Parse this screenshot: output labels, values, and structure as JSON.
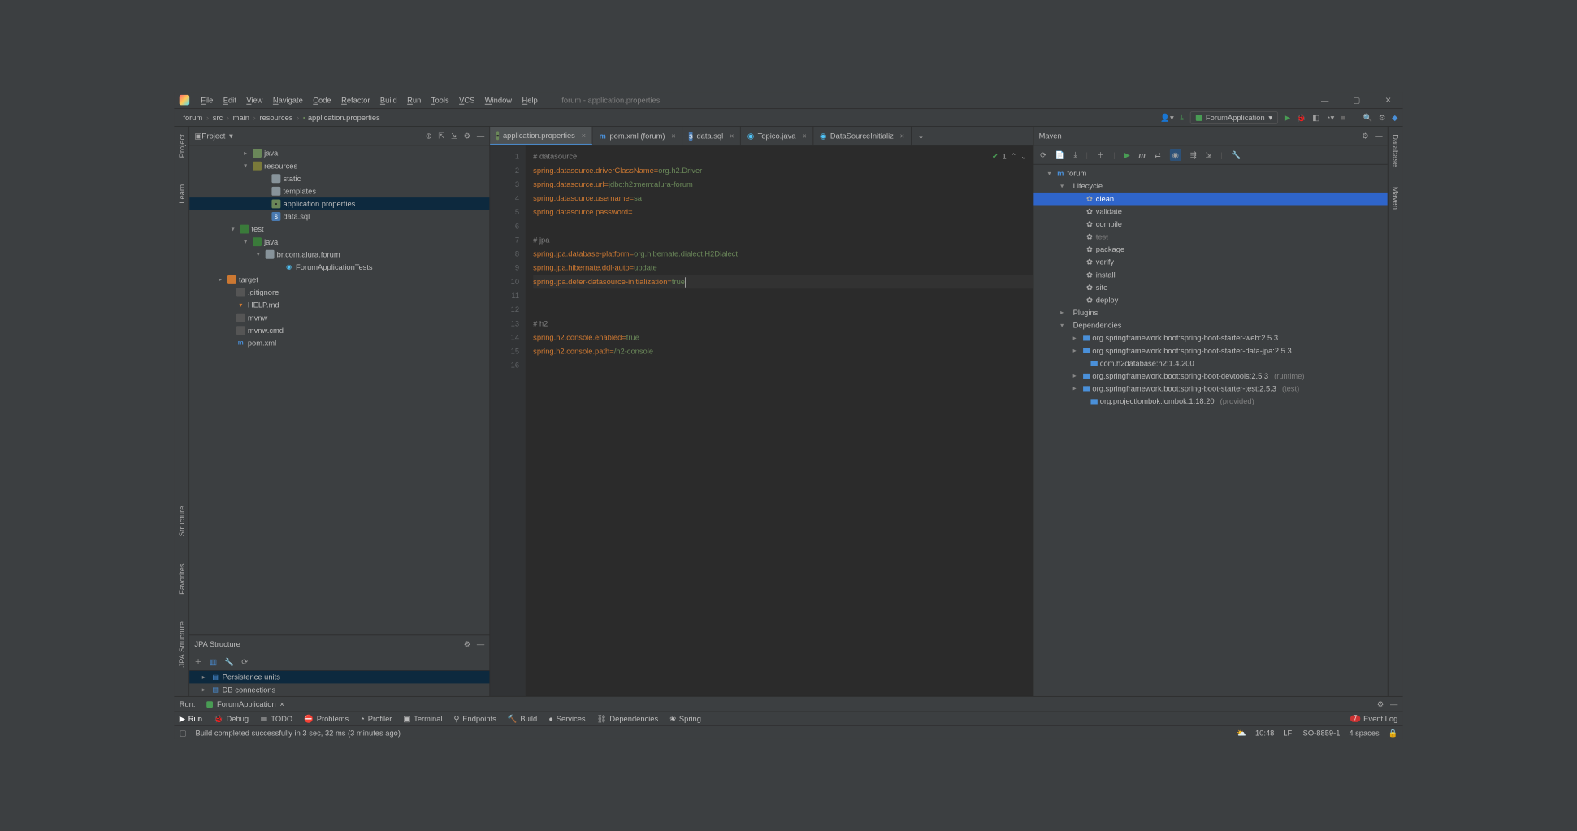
{
  "window": {
    "title": "forum - application.properties"
  },
  "menu": [
    "File",
    "Edit",
    "View",
    "Navigate",
    "Code",
    "Refactor",
    "Build",
    "Run",
    "Tools",
    "VCS",
    "Window",
    "Help"
  ],
  "breadcrumb": [
    "forum",
    "src",
    "main",
    "resources",
    "application.properties"
  ],
  "runConfig": "ForumApplication",
  "leftTabs": [
    "Project",
    "Learn",
    "Structure",
    "Favorites",
    "JPA Structure"
  ],
  "rightTabs": [
    "Database",
    "Maven"
  ],
  "projectHeader": "Project",
  "tree": [
    {
      "ind": 86,
      "exp": "▸",
      "icon": "folder",
      "label": "java"
    },
    {
      "ind": 86,
      "exp": "▾",
      "icon": "folder-res",
      "label": "resources"
    },
    {
      "ind": 116,
      "exp": "",
      "icon": "folder-plain",
      "label": "static"
    },
    {
      "ind": 116,
      "exp": "",
      "icon": "folder-plain",
      "label": "templates"
    },
    {
      "ind": 116,
      "exp": "",
      "icon": "prop",
      "label": "application.properties",
      "sel": true
    },
    {
      "ind": 116,
      "exp": "",
      "icon": "sql",
      "label": "data.sql"
    },
    {
      "ind": 66,
      "exp": "▾",
      "icon": "folder-test",
      "label": "test"
    },
    {
      "ind": 86,
      "exp": "▾",
      "icon": "folder-test",
      "label": "java"
    },
    {
      "ind": 106,
      "exp": "▾",
      "icon": "folder-plain",
      "label": "br.com.alura.forum"
    },
    {
      "ind": 136,
      "exp": "",
      "icon": "class",
      "label": "ForumApplicationTests"
    },
    {
      "ind": 46,
      "exp": "▸",
      "icon": "folder-target",
      "label": "target"
    },
    {
      "ind": 60,
      "exp": "",
      "icon": "file",
      "label": ".gitignore"
    },
    {
      "ind": 60,
      "exp": "",
      "icon": "md",
      "label": "HELP.md"
    },
    {
      "ind": 60,
      "exp": "",
      "icon": "file",
      "label": "mvnw"
    },
    {
      "ind": 60,
      "exp": "",
      "icon": "file",
      "label": "mvnw.cmd"
    },
    {
      "ind": 60,
      "exp": "",
      "icon": "m",
      "label": "pom.xml"
    }
  ],
  "jpa": {
    "header": "JPA Structure",
    "rows": [
      "Persistence units",
      "DB connections"
    ]
  },
  "tabs": [
    {
      "icon": "prop",
      "label": "application.properties",
      "active": true
    },
    {
      "icon": "m",
      "label": "pom.xml (forum)"
    },
    {
      "icon": "sql",
      "label": "data.sql"
    },
    {
      "icon": "kt",
      "label": "Topico.java"
    },
    {
      "icon": "kt",
      "label": "DataSourceInitializ"
    }
  ],
  "code": [
    {
      "t": "comment",
      "v": "# datasource"
    },
    {
      "t": "kv",
      "k": "spring.datasource.driverClassName",
      "v": "org.h2.Driver"
    },
    {
      "t": "kv",
      "k": "spring.datasource.url",
      "v": "jdbc:h2:mem:alura-forum"
    },
    {
      "t": "kv",
      "k": "spring.datasource.username",
      "v": "sa"
    },
    {
      "t": "kv",
      "k": "spring.datasource.password",
      "v": ""
    },
    {
      "t": "blank"
    },
    {
      "t": "comment",
      "v": "# jpa"
    },
    {
      "t": "kv",
      "k": "spring.jpa.database-platform",
      "v": "org.hibernate.dialect.H2Dialect"
    },
    {
      "t": "kv",
      "k": "spring.jpa.hibernate.ddl-auto",
      "v": "update"
    },
    {
      "t": "kv",
      "k": "spring.jpa.defer-datasource-initialization",
      "v": "true",
      "curr": true
    },
    {
      "t": "blank"
    },
    {
      "t": "blank"
    },
    {
      "t": "comment",
      "v": "# h2"
    },
    {
      "t": "kv",
      "k": "spring.h2.console.enabled",
      "v": "true"
    },
    {
      "t": "kv",
      "k": "spring.h2.console.path",
      "v": "/h2-console"
    },
    {
      "t": "blank"
    }
  ],
  "inspections": "1",
  "maven": {
    "header": "Maven",
    "tree": [
      {
        "ind": 10,
        "exp": "▾",
        "icon": "m",
        "label": "forum"
      },
      {
        "ind": 30,
        "exp": "▾",
        "icon": "folder-plain",
        "label": "Lifecycle"
      },
      {
        "ind": 56,
        "exp": "",
        "icon": "gear",
        "label": "clean",
        "sel": true
      },
      {
        "ind": 56,
        "exp": "",
        "icon": "gear",
        "label": "validate"
      },
      {
        "ind": 56,
        "exp": "",
        "icon": "gear",
        "label": "compile"
      },
      {
        "ind": 56,
        "exp": "",
        "icon": "gear",
        "label": "test",
        "dim": true
      },
      {
        "ind": 56,
        "exp": "",
        "icon": "gear",
        "label": "package"
      },
      {
        "ind": 56,
        "exp": "",
        "icon": "gear",
        "label": "verify"
      },
      {
        "ind": 56,
        "exp": "",
        "icon": "gear",
        "label": "install"
      },
      {
        "ind": 56,
        "exp": "",
        "icon": "gear",
        "label": "site"
      },
      {
        "ind": 56,
        "exp": "",
        "icon": "gear",
        "label": "deploy"
      },
      {
        "ind": 30,
        "exp": "▸",
        "icon": "folder-plain",
        "label": "Plugins"
      },
      {
        "ind": 30,
        "exp": "▾",
        "icon": "folder-plain",
        "label": "Dependencies"
      },
      {
        "ind": 50,
        "exp": "▸",
        "icon": "bars",
        "label": "org.springframework.boot:spring-boot-starter-web:2.5.3"
      },
      {
        "ind": 50,
        "exp": "▸",
        "icon": "bars",
        "label": "org.springframework.boot:spring-boot-starter-data-jpa:2.5.3"
      },
      {
        "ind": 62,
        "exp": "",
        "icon": "bars",
        "label": "com.h2database:h2:1.4.200"
      },
      {
        "ind": 50,
        "exp": "▸",
        "icon": "bars",
        "label": "org.springframework.boot:spring-boot-devtools:2.5.3",
        "note": "(runtime)"
      },
      {
        "ind": 50,
        "exp": "▸",
        "icon": "bars",
        "label": "org.springframework.boot:spring-boot-starter-test:2.5.3",
        "note": "(test)"
      },
      {
        "ind": 62,
        "exp": "",
        "icon": "bars",
        "label": "org.projectlombok:lombok:1.18.20",
        "note": "(provided)"
      }
    ]
  },
  "runTab": {
    "label": "Run:",
    "name": "ForumApplication"
  },
  "bottomBar": [
    "Run",
    "Debug",
    "TODO",
    "Problems",
    "Profiler",
    "Terminal",
    "Endpoints",
    "Build",
    "Services",
    "Dependencies",
    "Spring"
  ],
  "bottomBarIcons": [
    "▶",
    "🐞",
    "≔",
    "⛔",
    "◔",
    "▣",
    "⚲",
    "🔨",
    "●",
    "⛓",
    "❀"
  ],
  "eventLog": {
    "badge": "7",
    "label": "Event Log"
  },
  "status": {
    "msg": "Build completed successfully in 3 sec, 32 ms (3 minutes ago)",
    "time": "10:48",
    "eol": "LF",
    "enc": "ISO-8859-1",
    "indent": "4 spaces"
  }
}
